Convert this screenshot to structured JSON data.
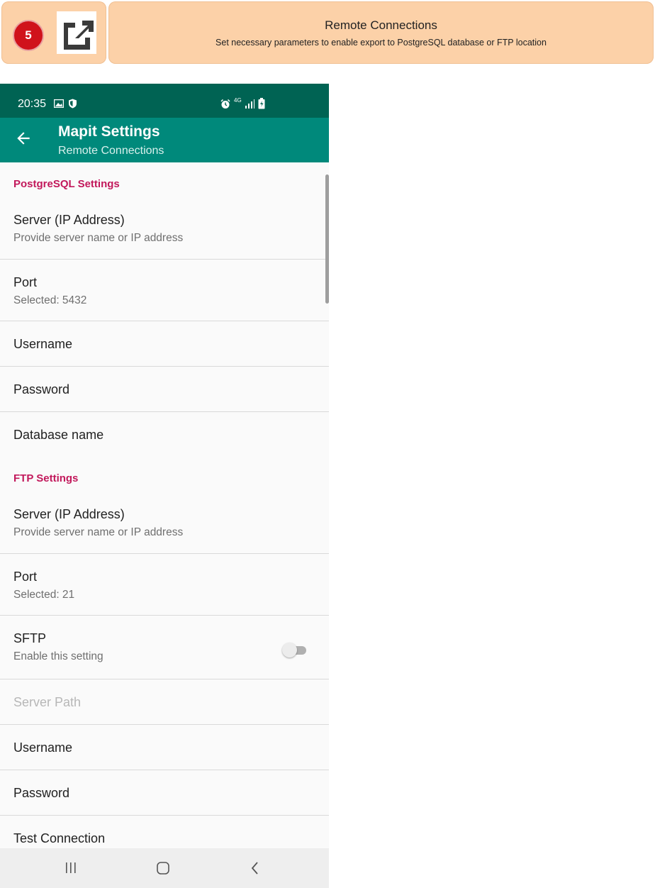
{
  "banner": {
    "step_number": "5",
    "icon": "external-link-icon",
    "title": "Remote Connections",
    "subtitle": "Set necessary parameters to enable export to PostgreSQL database or FTP location"
  },
  "statusbar": {
    "time": "20:35",
    "icons": [
      "image-icon",
      "shield-icon",
      "alarm-icon",
      "network-4g-icon",
      "signal-icon",
      "battery-charging-icon"
    ],
    "network_label": "4G"
  },
  "appbar": {
    "title": "Mapit Settings",
    "subtitle": "Remote Connections",
    "back_icon": "back-arrow-icon"
  },
  "postgres": {
    "header": "PostgreSQL Settings",
    "server": {
      "title": "Server (IP Address)",
      "summary": "Provide server name or IP address"
    },
    "port": {
      "title": "Port",
      "summary": "Selected: 5432"
    },
    "username": {
      "title": "Username"
    },
    "password": {
      "title": "Password"
    },
    "database": {
      "title": "Database name"
    }
  },
  "ftp": {
    "header": "FTP Settings",
    "server": {
      "title": "Server (IP Address)",
      "summary": "Provide server name or IP address"
    },
    "port": {
      "title": "Port",
      "summary": "Selected: 21"
    },
    "sftp": {
      "title": "SFTP",
      "summary": "Enable this setting",
      "enabled": false
    },
    "server_path": {
      "title": "Server Path",
      "disabled": true
    },
    "username": {
      "title": "Username"
    },
    "password": {
      "title": "Password"
    },
    "test": {
      "title": "Test Connection"
    }
  },
  "navbar": {
    "icons": [
      "recent-apps-icon",
      "home-icon",
      "back-icon"
    ]
  },
  "colors": {
    "statusbar": "#006353",
    "appbar": "#00897b",
    "section_header": "#c2185b",
    "banner": "#fcd1a8",
    "badge": "#d0121b"
  }
}
